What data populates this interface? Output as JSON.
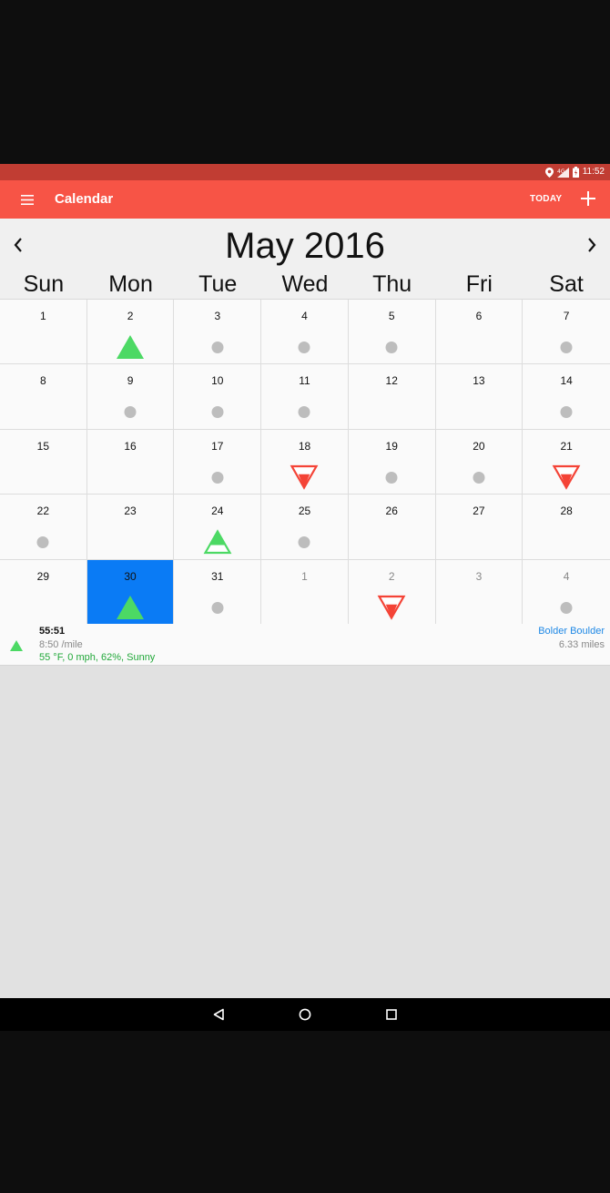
{
  "status_bar": {
    "time": "11:52",
    "icons": [
      "location-icon",
      "signal-icon",
      "battery-charging-icon"
    ]
  },
  "app_bar": {
    "title": "Calendar",
    "today_label": "TODAY",
    "icons": {
      "menu": "menu-icon",
      "add": "plus-icon"
    }
  },
  "calendar": {
    "month_title": "May 2016",
    "weekdays": [
      "Sun",
      "Mon",
      "Tue",
      "Wed",
      "Thu",
      "Fri",
      "Sat"
    ],
    "selected_day": "30",
    "days": [
      {
        "label": "1",
        "other": false,
        "mark": "none"
      },
      {
        "label": "2",
        "other": false,
        "mark": "up-full"
      },
      {
        "label": "3",
        "other": false,
        "mark": "dot"
      },
      {
        "label": "4",
        "other": false,
        "mark": "dot"
      },
      {
        "label": "5",
        "other": false,
        "mark": "dot"
      },
      {
        "label": "6",
        "other": false,
        "mark": "none"
      },
      {
        "label": "7",
        "other": false,
        "mark": "dot"
      },
      {
        "label": "8",
        "other": false,
        "mark": "none"
      },
      {
        "label": "9",
        "other": false,
        "mark": "dot"
      },
      {
        "label": "10",
        "other": false,
        "mark": "dot"
      },
      {
        "label": "11",
        "other": false,
        "mark": "dot"
      },
      {
        "label": "12",
        "other": false,
        "mark": "none"
      },
      {
        "label": "13",
        "other": false,
        "mark": "none"
      },
      {
        "label": "14",
        "other": false,
        "mark": "dot"
      },
      {
        "label": "15",
        "other": false,
        "mark": "none"
      },
      {
        "label": "16",
        "other": false,
        "mark": "none"
      },
      {
        "label": "17",
        "other": false,
        "mark": "dot"
      },
      {
        "label": "18",
        "other": false,
        "mark": "down-partial"
      },
      {
        "label": "19",
        "other": false,
        "mark": "dot"
      },
      {
        "label": "20",
        "other": false,
        "mark": "dot"
      },
      {
        "label": "21",
        "other": false,
        "mark": "down-partial"
      },
      {
        "label": "22",
        "other": false,
        "mark": "dot"
      },
      {
        "label": "23",
        "other": false,
        "mark": "none"
      },
      {
        "label": "24",
        "other": false,
        "mark": "up-partial"
      },
      {
        "label": "25",
        "other": false,
        "mark": "dot"
      },
      {
        "label": "26",
        "other": false,
        "mark": "none"
      },
      {
        "label": "27",
        "other": false,
        "mark": "none"
      },
      {
        "label": "28",
        "other": false,
        "mark": "none"
      },
      {
        "label": "29",
        "other": false,
        "mark": "none"
      },
      {
        "label": "30",
        "other": false,
        "mark": "up-full"
      },
      {
        "label": "31",
        "other": false,
        "mark": "dot"
      },
      {
        "label": "1",
        "other": true,
        "mark": "none"
      },
      {
        "label": "2",
        "other": true,
        "mark": "down-partial"
      },
      {
        "label": "3",
        "other": true,
        "mark": "none"
      },
      {
        "label": "4",
        "other": true,
        "mark": "dot"
      }
    ]
  },
  "workout": {
    "duration": "55:51",
    "pace": "8:50 /mile",
    "weather": "55 °F, 0 mph, 62%, Sunny",
    "route": "Bolder Boulder",
    "distance": "6.33 miles",
    "icon": "up-triangle-icon"
  },
  "nav_bar": {
    "icons": [
      "back-icon",
      "home-icon",
      "recents-icon"
    ]
  },
  "colors": {
    "status_bar": "#c13d33",
    "app_bar": "#f75446",
    "selected_day": "#0a7bf5",
    "up_marker": "#4cd964",
    "down_marker": "#f44336",
    "dot_marker": "#bdbdbd",
    "route_link": "#1e88e5",
    "weather_text": "#22a83a"
  }
}
